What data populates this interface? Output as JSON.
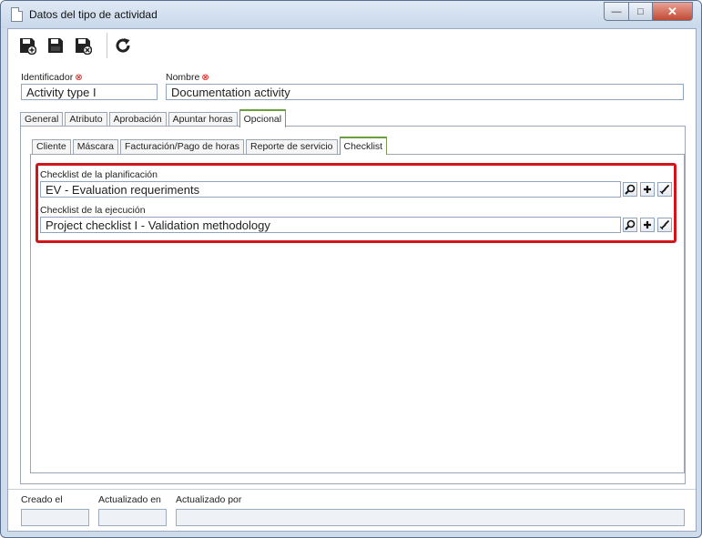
{
  "window": {
    "title": "Datos del tipo de actividad",
    "controls": {
      "minimize": "—",
      "maximize": "□",
      "close": "✕"
    }
  },
  "toolbar": {
    "buttons": [
      {
        "name": "save-new-button",
        "icon": "save-new-icon"
      },
      {
        "name": "save-button",
        "icon": "save-icon"
      },
      {
        "name": "save-close-button",
        "icon": "save-close-icon"
      },
      {
        "name": "refresh-button",
        "icon": "refresh-icon"
      }
    ]
  },
  "header": {
    "id_label": "Identificador",
    "id_value": "Activity type I",
    "name_label": "Nombre",
    "name_value": "Documentation activity",
    "required_mark": "⊗"
  },
  "tabs": [
    "General",
    "Atributo",
    "Aprobación",
    "Apuntar horas",
    "Opcional"
  ],
  "active_tab": "Opcional",
  "subtabs": [
    "Cliente",
    "Máscara",
    "Facturación/Pago de horas",
    "Reporte de servicio",
    "Checklist"
  ],
  "active_subtab": "Checklist",
  "checklist": {
    "planning_label": "Checklist de la planificación",
    "planning_value": "EV - Evaluation requeriments",
    "execution_label": "Checklist de la ejecución",
    "execution_value": "Project checklist I - Validation methodology",
    "button_icons": [
      "search-icon",
      "add-icon",
      "clear-icon"
    ]
  },
  "footer": {
    "created_label": "Creado el",
    "created_value": "",
    "updated_label": "Actualizado en",
    "updated_value": "",
    "updated_by_label": "Actualizado por",
    "updated_by_value": ""
  },
  "colors": {
    "highlight": "#d0161a",
    "active_tab_accent": "#6aa03b",
    "required": "#dd0000"
  }
}
